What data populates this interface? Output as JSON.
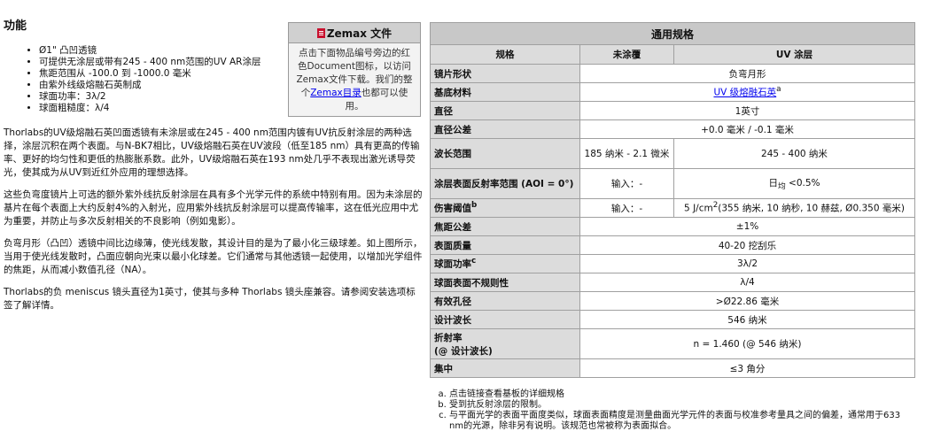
{
  "features": {
    "title": "功能",
    "items": [
      "Ø1\" 凸凹透镜",
      "可提供无涂层或带有245 - 400 nm范围的UV AR涂层",
      "焦距范围从 -100.0 到 -1000.0 毫米",
      "由紫外线级熔融石英制成",
      "球面功率：3λ/2",
      "球面粗糙度：λ/4"
    ]
  },
  "paragraphs": [
    "Thorlabs的UV级熔融石英凹面透镜有未涂层或在245 - 400 nm范围内镀有UV抗反射涂层的两种选择，涂层沉积在两个表面。与N-BK7相比，UV级熔融石英在UV波段（低至185 nm）具有更高的传输率、更好的均匀性和更低的热膨胀系数。此外，UV级熔融石英在193 nm处几乎不表现出激光诱导荧光，使其成为从UV到近红外应用的理想选择。",
    "这些负弯度镜片上可选的额外紫外线抗反射涂层在具有多个光学元件的系统中特别有用。因为未涂层的基片在每个表面上大约反射4%的入射光，应用紫外线抗反射涂层可以提高传输率，这在低光应用中尤为重要，并防止与多次反射相关的不良影响（例如鬼影）。",
    "负弯月形（凸凹）透镜中间比边缘薄，使光线发散，其设计目的是为了最小化三级球差。如上图所示，当用于使光线发散时，凸面应朝向光束以最小化球差。它们通常与其他透镜一起使用，以增加光学组件的焦距，从而减小数值孔径（NA）。",
    "Thorlabs的负 meniscus 镜头直径为1英寸，使其与多种 Thorlabs 镜头座兼容。请参阅安装选项标签了解详情。"
  ],
  "zemax": {
    "title": "Zemax 文件",
    "text_before": "点击下面物品编号旁边的红色Document图标，以访问Zemax文件下载。我们的整个",
    "link": "Zemax目录",
    "text_after": "也都可以使用。"
  },
  "spec": {
    "title": "通用规格",
    "headers": [
      "规格",
      "未涂覆",
      "UV 涂层"
    ],
    "rows": [
      {
        "label": "镜片形状",
        "value": "负弯月形"
      },
      {
        "label": "基底材料",
        "link": "UV 级熔融石英",
        "sup": "a"
      },
      {
        "label": "直径",
        "value": "1英寸"
      },
      {
        "label": "直径公差",
        "value": "+0.0 毫米 / -0.1 毫米"
      },
      {
        "label": "波长范围",
        "uncoated": "185 纳米 - 2.1 微米",
        "coated": "245 - 400 纳米"
      },
      {
        "label": "涂层表面反射率范围 (AOI = 0°)",
        "uncoated": "输入：-",
        "coated_pre": "日",
        "coated_sub": "均",
        "coated_post": " <0.5%"
      },
      {
        "label": "伤害阈值",
        "label_sup": "b",
        "uncoated": "输入：-",
        "coated_pre": "5 J/cm",
        "coated_sup": "2",
        "coated_post": "(355 纳米, 10 纳秒, 10 赫兹, Ø0.350 毫米)"
      },
      {
        "label": "焦距公差",
        "value": "±1%"
      },
      {
        "label": "表面质量",
        "value": "40-20 挖刮乐"
      },
      {
        "label": "球面功率",
        "label_sup": "c",
        "value": "3λ/2"
      },
      {
        "label": "球面表面不规则性",
        "value": "λ/4"
      },
      {
        "label": "有效孔径",
        "value": ">Ø22.86 毫米"
      },
      {
        "label": "设计波长",
        "value": "546 纳米"
      },
      {
        "label": "折射率",
        "label2": "(@ 设计波长)",
        "value": "n = 1.460 (@ 546 纳米)"
      },
      {
        "label": "集中",
        "value": "≤3 角分"
      }
    ]
  },
  "notes": [
    "点击链接查看基板的详细规格",
    "受到抗反射涂层的限制。",
    "与平面光学的表面平面度类似，球面表面精度是测量曲面光学元件的表面与校准参考量具之间的偏差，通常用于633 nm的光源，除非另有说明。该规范也常被称为表面拟合。"
  ]
}
